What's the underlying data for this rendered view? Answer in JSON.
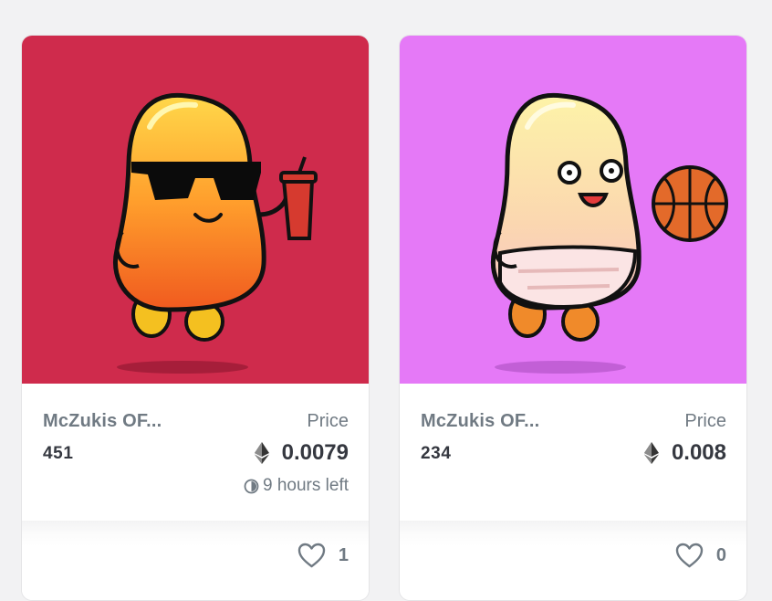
{
  "cards": [
    {
      "collection": "McZukis OF...",
      "token_id": "451",
      "price_label": "Price",
      "price": "0.0079",
      "time_left": "9 hours left",
      "likes": "1",
      "background_color": "#cf2b4c",
      "icons": {
        "currency": "ethereum-icon",
        "time": "clock-icon",
        "favorite": "heart-icon"
      }
    },
    {
      "collection": "McZukis OF...",
      "token_id": "234",
      "price_label": "Price",
      "price": "0.008",
      "likes": "0",
      "background_color": "#e579f7",
      "icons": {
        "currency": "ethereum-icon",
        "favorite": "heart-icon"
      }
    }
  ]
}
